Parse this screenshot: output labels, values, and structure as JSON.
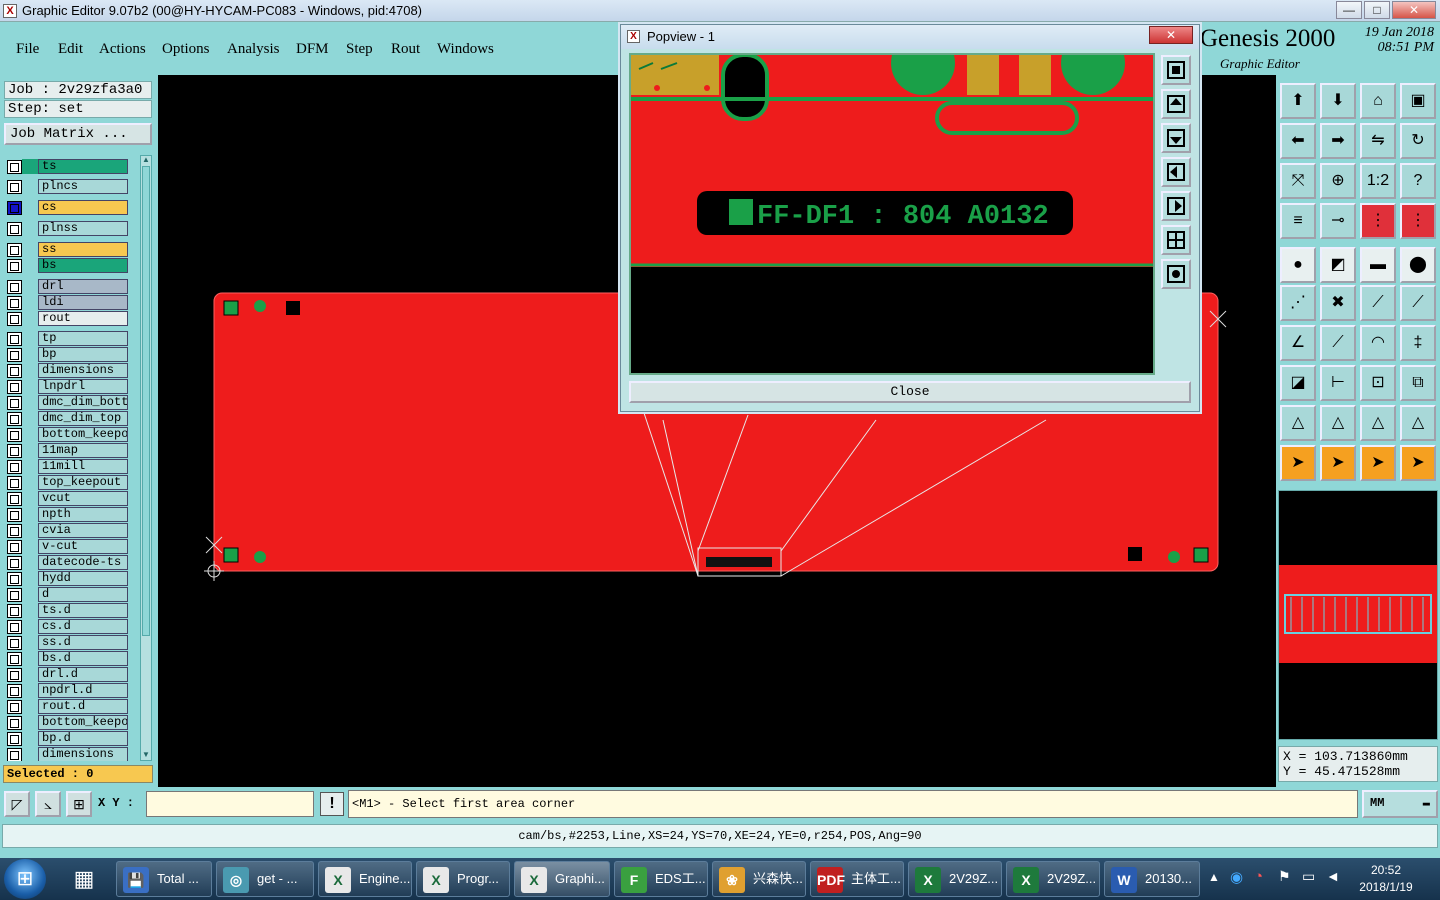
{
  "window": {
    "title": "Graphic Editor 9.07b2 (00@HY-HYCAM-PC083 - Windows, pid:4708)",
    "min": "—",
    "max": "□",
    "close": "✕"
  },
  "menu": [
    "File",
    "Edit",
    "Actions",
    "Options",
    "Analysis",
    "DFM",
    "Step",
    "Rout",
    "Windows"
  ],
  "header": {
    "brand": "Genesis 2000",
    "date": "19 Jan 2018",
    "time": "08:51 PM",
    "subtitle": "Graphic Editor"
  },
  "job": {
    "job_line": "Job : 2v29zfa3a0",
    "step_line": "Step: set",
    "matrix_button": "Job Matrix ..."
  },
  "layers": [
    {
      "name": "ts",
      "color": "#1aa57a"
    },
    {
      "name": "plncs",
      "color": "#a8d8d8"
    },
    {
      "name": "cs",
      "color": "#f7c850"
    },
    {
      "name": "plnss",
      "color": "#a8d8d8"
    },
    {
      "name": "ss",
      "color": "#f7c850"
    },
    {
      "name": "bs",
      "color": "#1aa57a"
    },
    {
      "name": "drl",
      "color": "#a8b8c8"
    },
    {
      "name": "ldi",
      "color": "#a8b8c8"
    },
    {
      "name": "rout",
      "color": "#e6eeee"
    },
    {
      "name": "tp",
      "color": "#a8d8d8"
    },
    {
      "name": "bp",
      "color": "#a8d8d8"
    },
    {
      "name": "dimensions",
      "color": "#a8d8d8"
    },
    {
      "name": "lnpdrl",
      "color": "#a8d8d8"
    },
    {
      "name": "dmc_dim_bott",
      "color": "#a8d8d8"
    },
    {
      "name": "dmc_dim_top",
      "color": "#a8d8d8"
    },
    {
      "name": "bottom_keepo",
      "color": "#a8d8d8"
    },
    {
      "name": "11map",
      "color": "#a8d8d8"
    },
    {
      "name": "11mill",
      "color": "#a8d8d8"
    },
    {
      "name": "top_keepout",
      "color": "#a8d8d8"
    },
    {
      "name": "vcut",
      "color": "#a8d8d8"
    },
    {
      "name": "npth",
      "color": "#a8d8d8"
    },
    {
      "name": "cvia",
      "color": "#a8d8d8"
    },
    {
      "name": "v-cut",
      "color": "#a8d8d8"
    },
    {
      "name": "datecode-ts",
      "color": "#a8d8d8"
    },
    {
      "name": "hydd",
      "color": "#a8d8d8"
    },
    {
      "name": "d",
      "color": "#a8d8d8"
    },
    {
      "name": "ts.d",
      "color": "#a8d8d8"
    },
    {
      "name": "cs.d",
      "color": "#a8d8d8"
    },
    {
      "name": "ss.d",
      "color": "#a8d8d8"
    },
    {
      "name": "bs.d",
      "color": "#a8d8d8"
    },
    {
      "name": "drl.d",
      "color": "#a8d8d8"
    },
    {
      "name": "npdrl.d",
      "color": "#a8d8d8"
    },
    {
      "name": "rout.d",
      "color": "#a8d8d8"
    },
    {
      "name": "bottom_keepo",
      "color": "#a8d8d8"
    },
    {
      "name": "bp.d",
      "color": "#a8d8d8"
    },
    {
      "name": "dimensions",
      "color": "#a8d8d8"
    }
  ],
  "selected_label": "Selected : 0",
  "popview": {
    "title": "Popview - 1",
    "close_button": "Close",
    "marking": "FF-DF1 : 804  A0132"
  },
  "coords": {
    "x": "X = 103.713860mm",
    "y": "Y = 45.471528mm"
  },
  "command": {
    "xy_label": "X Y :",
    "xy_value": "",
    "excl": "!",
    "message": "<M1> - Select first area corner",
    "unit": "MM"
  },
  "status_line": "cam/bs,#2253,Line,XS=24,YS=70,XE=24,YE=0,r254,POS,Ang=90",
  "taskbar": {
    "items": [
      {
        "label": "Total ...",
        "icon": "💾",
        "bg": "#3a6fc4"
      },
      {
        "label": "get - ...",
        "icon": "◎",
        "bg": "#4a9ab0"
      },
      {
        "label": "Engine...",
        "icon": "X",
        "bg": "#e8e8e8"
      },
      {
        "label": "Progr...",
        "icon": "X",
        "bg": "#e8e8e8"
      },
      {
        "label": "Graphi...",
        "icon": "X",
        "bg": "#e8e8e8"
      },
      {
        "label": "EDS工...",
        "icon": "F",
        "bg": "#3aa040"
      },
      {
        "label": "兴森快...",
        "icon": "❀",
        "bg": "#e0a030"
      },
      {
        "label": "主体工...",
        "icon": "PDF",
        "bg": "#c02020"
      },
      {
        "label": "2V29Z...",
        "icon": "X",
        "bg": "#1e7a3c"
      },
      {
        "label": "2V29Z...",
        "icon": "X",
        "bg": "#1e7a3c"
      },
      {
        "label": "20130...",
        "icon": "W",
        "bg": "#2a5cb0"
      }
    ],
    "time": "20:52",
    "date": "2018/1/19"
  }
}
